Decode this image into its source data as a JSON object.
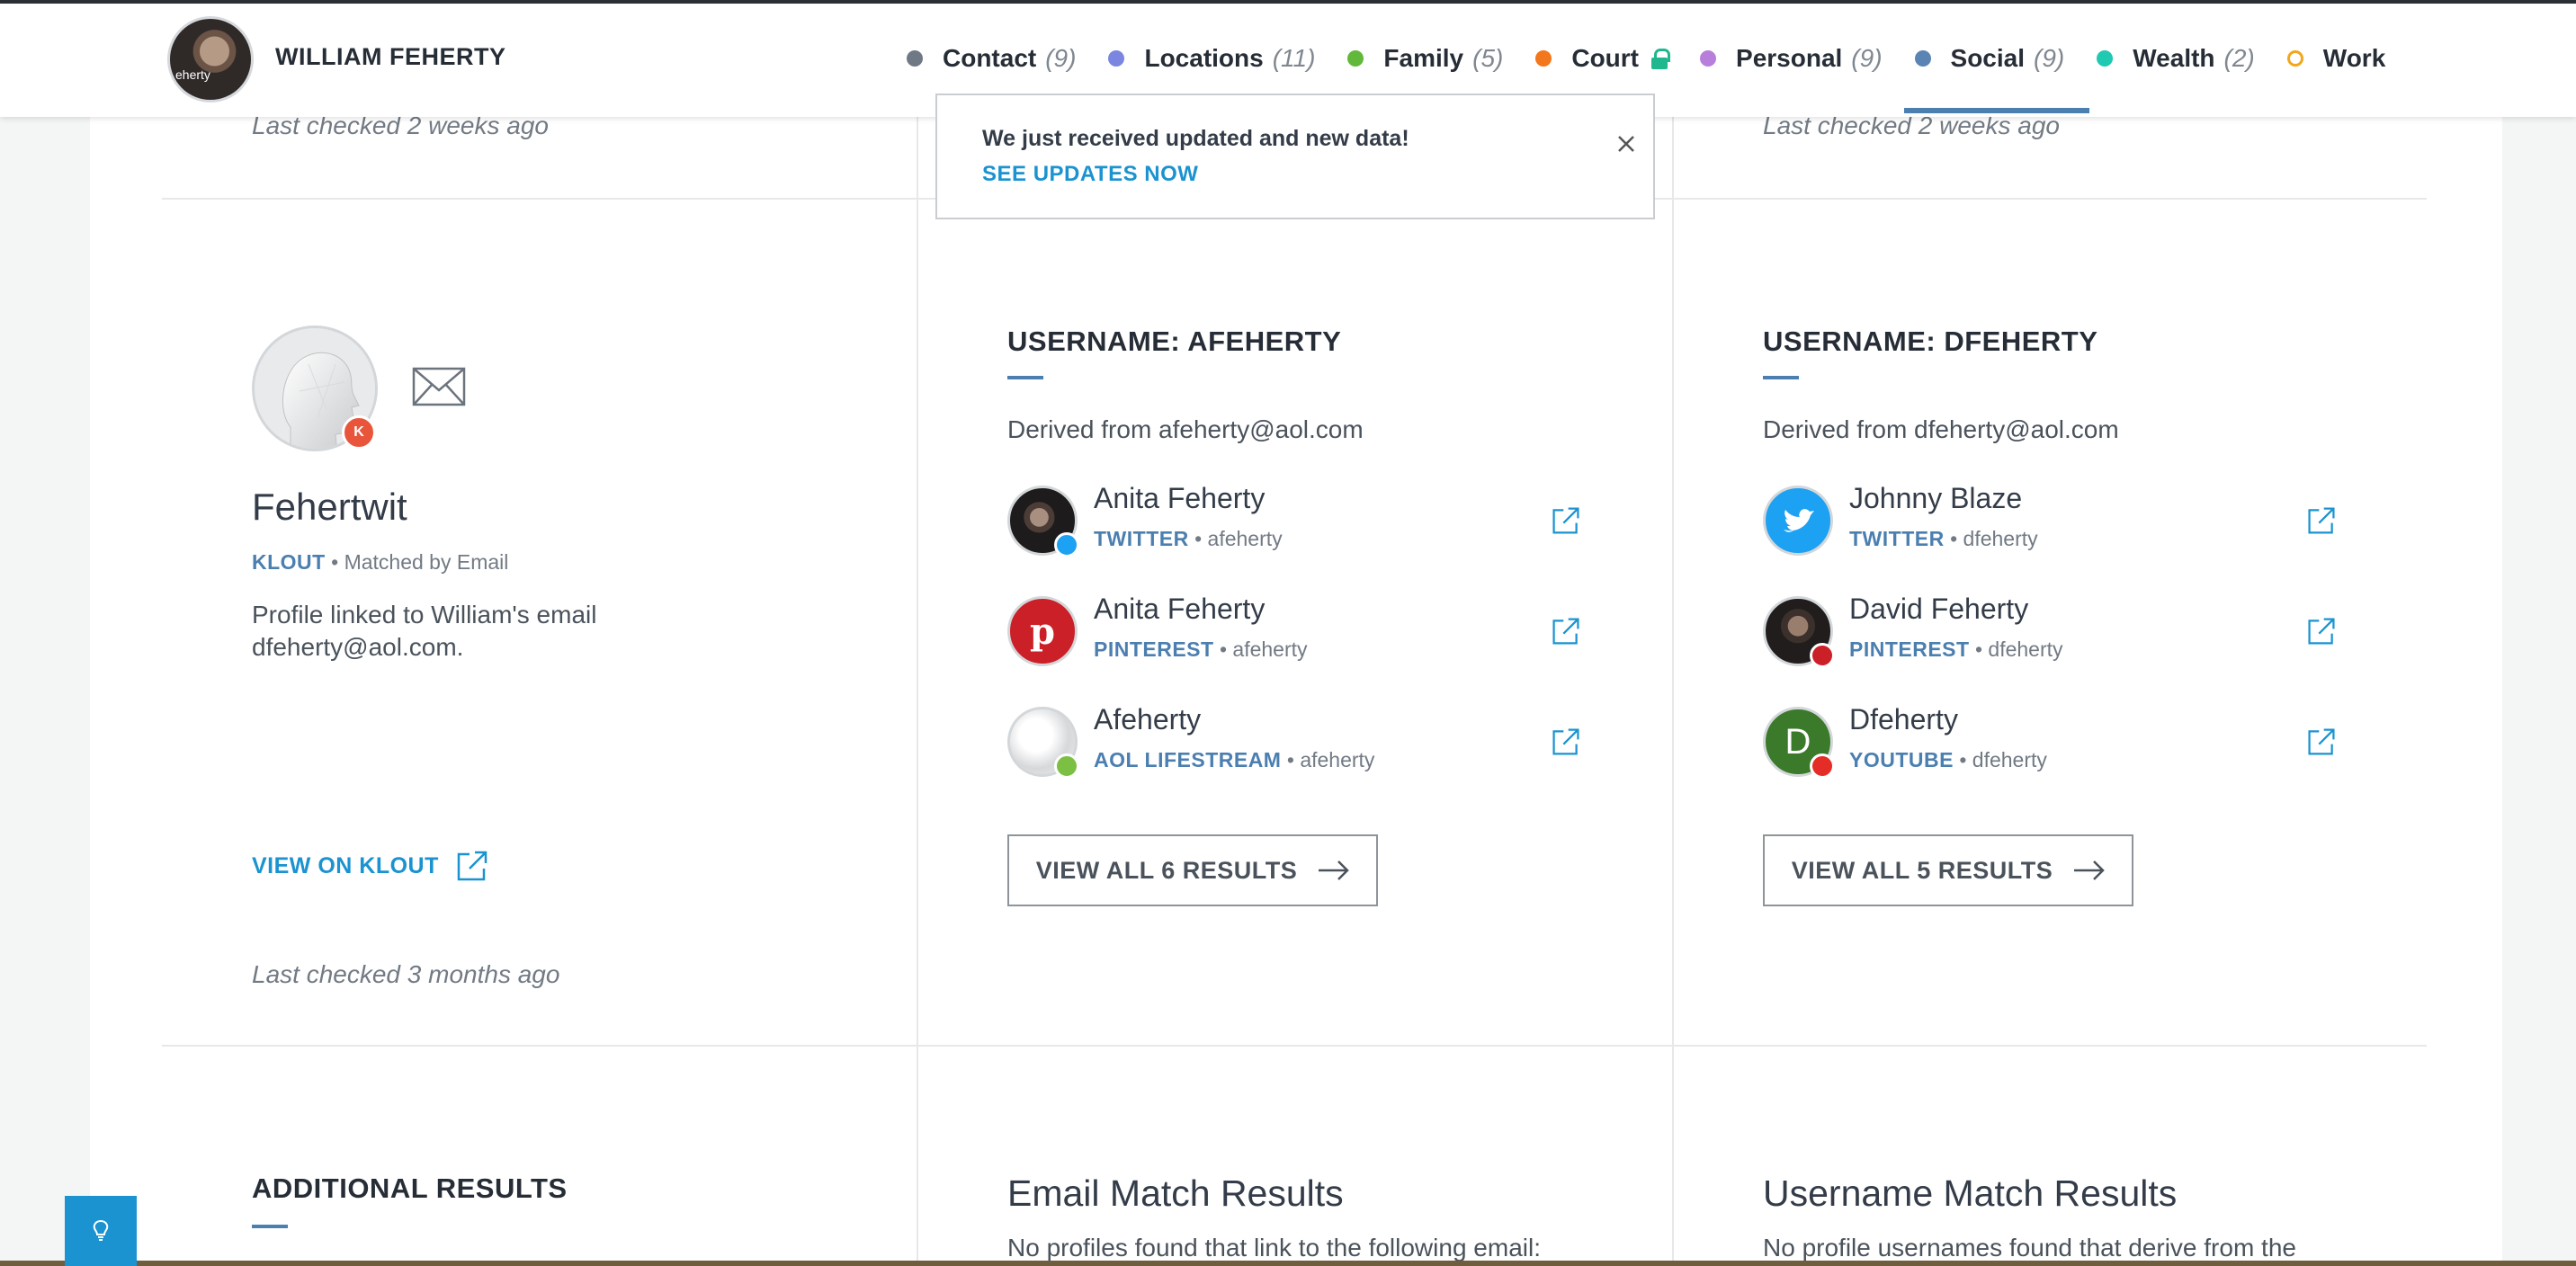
{
  "header": {
    "name": "WILLIAM FEHERTY",
    "avatar_caption": "eherty",
    "nav": [
      {
        "label": "Contact",
        "count": "(9)",
        "color": "#6f7985",
        "hollow": false
      },
      {
        "label": "Locations",
        "count": "(11)",
        "color": "#7b86e0",
        "hollow": false
      },
      {
        "label": "Family",
        "count": "(5)",
        "color": "#62b83a",
        "hollow": false
      },
      {
        "label": "Court",
        "count": "",
        "color": "#f2771d",
        "hollow": false,
        "locked": true
      },
      {
        "label": "Personal",
        "count": "(9)",
        "color": "#b77fdb",
        "hollow": false
      },
      {
        "label": "Social",
        "count": "(9)",
        "color": "#5a84b3",
        "hollow": false,
        "active": true
      },
      {
        "label": "Wealth",
        "count": "(2)",
        "color": "#20c9b1",
        "hollow": false
      },
      {
        "label": "Work",
        "count": "",
        "color": "#f2a71b",
        "hollow": true
      }
    ]
  },
  "top_last_checked": {
    "left": "Last checked 2 weeks ago",
    "right": "Last checked 2 weeks ago"
  },
  "notification": {
    "message": "We just received updated and new data!",
    "link": "SEE UPDATES NOW"
  },
  "klout": {
    "name": "Fehertwit",
    "source": "KLOUT",
    "match": "Matched by Email",
    "description": "Profile linked to William's email dfeherty@aol.com.",
    "link": "VIEW ON KLOUT",
    "last_checked": "Last checked 3 months ago"
  },
  "usernames": [
    {
      "heading": "USERNAME: AFEHERTY",
      "derived": "Derived from afeherty@aol.com",
      "profiles": [
        {
          "name": "Anita Feherty",
          "site": "TWITTER",
          "handle": "afeherty",
          "badge": "twitter"
        },
        {
          "name": "Anita Feherty",
          "site": "PINTEREST",
          "handle": "afeherty",
          "badge": "pinterest"
        },
        {
          "name": "Afeherty",
          "site": "AOL LIFESTREAM",
          "handle": "afeherty",
          "badge": "aol"
        }
      ],
      "view_all": "VIEW ALL 6 RESULTS"
    },
    {
      "heading": "USERNAME: DFEHERTY",
      "derived": "Derived from dfeherty@aol.com",
      "profiles": [
        {
          "name": "Johnny Blaze",
          "site": "TWITTER",
          "handle": "dfeherty",
          "badge": "twitter"
        },
        {
          "name": "David Feherty",
          "site": "PINTEREST",
          "handle": "dfeherty",
          "badge": "pinterest"
        },
        {
          "name": "Dfeherty",
          "site": "YOUTUBE",
          "handle": "dfeherty",
          "badge": "youtube",
          "initial": "D"
        }
      ],
      "view_all": "VIEW ALL 5 RESULTS"
    }
  ],
  "additional": {
    "heading": "ADDITIONAL RESULTS",
    "email_title": "Email Match Results",
    "email_text": "No profiles found that link to the following email:",
    "username_title": "Username Match Results",
    "username_text": "No profile usernames found that derive from the"
  }
}
